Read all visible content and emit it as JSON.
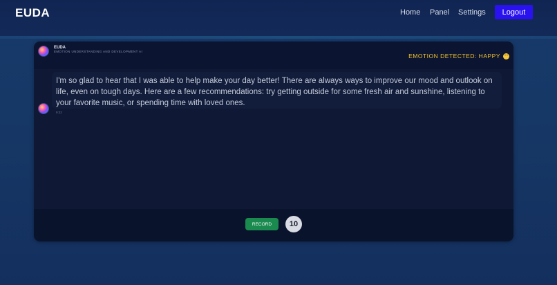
{
  "navbar": {
    "brand": "EUDA",
    "links": {
      "home": "Home",
      "panel": "Panel",
      "settings": "Settings"
    },
    "logout_label": "Logout"
  },
  "chat": {
    "bot_name": "EUDA",
    "bot_subtitle": "EMOTION UNDERSTANDING AND DEVELOPMENT AI",
    "emotion_label": "EMOTION DETECTED: HAPPY",
    "emotion_icon": "smiley-face-emoji",
    "messages": [
      {
        "sender": "EUDA",
        "text": "I'm so glad to hear that I was able to help make your day better! There are always ways to improve our mood and outlook on life, even on tough days. Here are a few recommendations: try getting outside for some fresh air and sunshine, listening to your favorite music, or spending time with loved ones.",
        "time": "9:22"
      }
    ],
    "record_label": "RECORD",
    "timer_value": "10"
  },
  "colors": {
    "accent_logout": "#2a12f0",
    "record_green": "#1a8a4e",
    "emotion_yellow": "#f2c230"
  }
}
